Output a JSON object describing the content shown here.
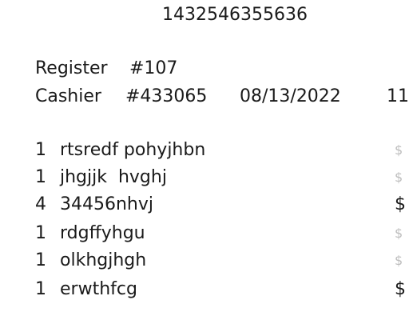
{
  "receipt": {
    "barcode_number": "1432546355636",
    "register": {
      "label": "Register",
      "number": "#107"
    },
    "cashier": {
      "label": "Cashier",
      "number": "#433065",
      "date": "08/13/2022",
      "time_fragment": "11"
    },
    "items": [
      {
        "qty": "1",
        "name": "rtsredf pohyjhbn",
        "price_fragment": "$"
      },
      {
        "qty": "1",
        "name": "jhgjjk  hvghj",
        "price_fragment": "$"
      },
      {
        "qty": "4",
        "name": "34456nhvj",
        "price_fragment": "$"
      },
      {
        "qty": "1",
        "name": "rdgffyhgu",
        "price_fragment": "$"
      },
      {
        "qty": "1",
        "name": "olkhgjhgh",
        "price_fragment": "$"
      },
      {
        "qty": "1",
        "name": "erwthfcg",
        "price_fragment": "$"
      }
    ]
  }
}
